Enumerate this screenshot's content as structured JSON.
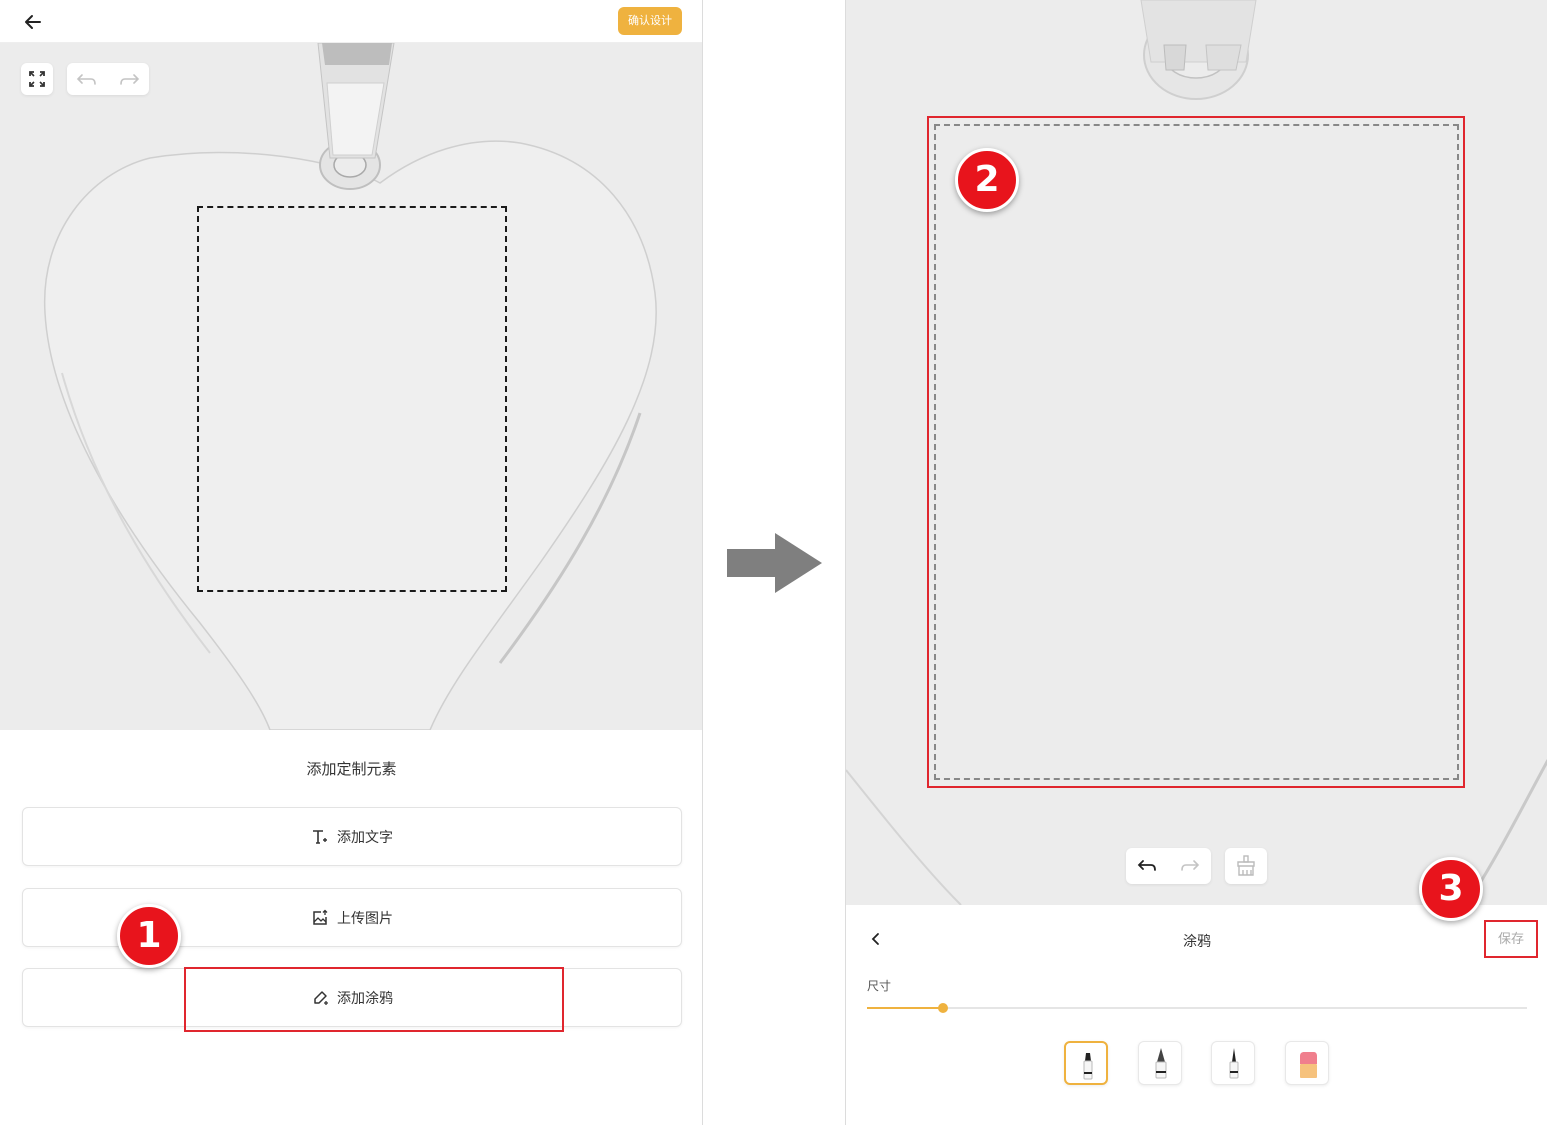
{
  "left": {
    "header": {
      "back_icon": "arrow-left-icon",
      "confirm_label": "确认设计"
    },
    "toolbar": {
      "fullscreen_icon": "expand-icon",
      "undo_icon": "undo-icon",
      "redo_icon": "redo-icon"
    },
    "sheet": {
      "title": "添加定制元素",
      "buttons": [
        {
          "label": "添加文字",
          "icon": "text-add-icon"
        },
        {
          "label": "上传图片",
          "icon": "image-upload-icon"
        },
        {
          "label": "添加涂鸦",
          "icon": "brush-icon"
        }
      ]
    }
  },
  "right": {
    "toolbar": {
      "undo_icon": "undo-icon",
      "redo_icon": "redo-icon",
      "clear_icon": "broom-icon"
    },
    "sheet": {
      "back_icon": "chevron-left-icon",
      "title": "涂鸦",
      "save_label": "保存",
      "size_label": "尺寸",
      "size_value_fraction": 0.115,
      "brushes": [
        {
          "icon": "marker-pen-icon",
          "selected": true
        },
        {
          "icon": "fountain-pen-icon",
          "selected": false
        },
        {
          "icon": "fine-pen-icon",
          "selected": false
        },
        {
          "icon": "eraser-icon",
          "selected": false
        }
      ]
    }
  },
  "annotations": {
    "step1": "1",
    "step2": "2",
    "step3": "3"
  },
  "colors": {
    "accent": "#efb23f",
    "highlight": "#e0262e",
    "badge": "#e8141c",
    "canvas": "#ececec"
  }
}
